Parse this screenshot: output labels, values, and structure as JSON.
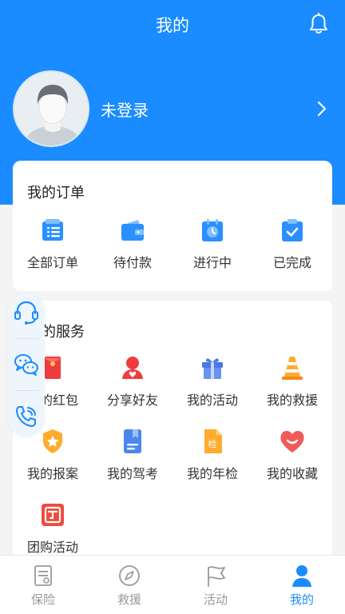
{
  "header": {
    "title": "我的"
  },
  "profile": {
    "name": "未登录"
  },
  "orders": {
    "title": "我的订单",
    "items": [
      {
        "label": "全部订单",
        "icon": "list-icon"
      },
      {
        "label": "待付款",
        "icon": "wallet-icon"
      },
      {
        "label": "进行中",
        "icon": "clock-icon"
      },
      {
        "label": "已完成",
        "icon": "clipboard-check-icon"
      }
    ]
  },
  "services": {
    "title": "我的服务",
    "items": [
      {
        "label": "我的红包",
        "icon": "red-envelope-icon"
      },
      {
        "label": "分享好友",
        "icon": "share-friend-icon"
      },
      {
        "label": "我的活动",
        "icon": "gift-icon"
      },
      {
        "label": "我的救援",
        "icon": "traffic-cone-icon"
      },
      {
        "label": "我的报案",
        "icon": "shield-star-icon"
      },
      {
        "label": "我的驾考",
        "icon": "book-icon"
      },
      {
        "label": "我的年检",
        "icon": "inspection-doc-icon"
      },
      {
        "label": "我的收藏",
        "icon": "heart-smile-icon"
      },
      {
        "label": "团购活动",
        "icon": "group-buy-icon"
      }
    ]
  },
  "tabs": [
    {
      "label": "保险",
      "icon": "insurance-doc-icon",
      "active": false
    },
    {
      "label": "救援",
      "icon": "compass-icon",
      "active": false
    },
    {
      "label": "活动",
      "icon": "flag-icon",
      "active": false
    },
    {
      "label": "我的",
      "icon": "person-icon",
      "active": true
    }
  ],
  "colors": {
    "primary": "#1a8cff",
    "inactive": "#999999"
  }
}
